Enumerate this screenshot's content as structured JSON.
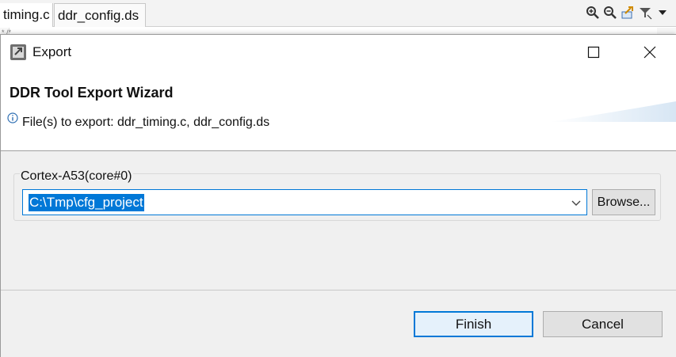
{
  "editor": {
    "tabs": [
      {
        "label": "timing.c"
      },
      {
        "label": "ddr_config.ds"
      }
    ],
    "toolbar_icons": [
      "zoom-in-icon",
      "zoom-out-icon",
      "export-icon",
      "filter-icon",
      "dropdown-icon"
    ],
    "gutter_text": "* /*"
  },
  "dialog": {
    "title": "Export",
    "wizard_title": "DDR Tool Export Wizard",
    "info_text": "File(s) to export: ddr_timing.c, ddr_config.ds",
    "group_label": "Cortex-A53(core#0)",
    "path_value": "C:\\Tmp\\cfg_project",
    "browse_label": "Browse...",
    "finish_label": "Finish",
    "cancel_label": "Cancel"
  },
  "colors": {
    "accent": "#0078d7",
    "dialog_bg": "#f0f0f0",
    "button_bg": "#e1e1e1"
  }
}
